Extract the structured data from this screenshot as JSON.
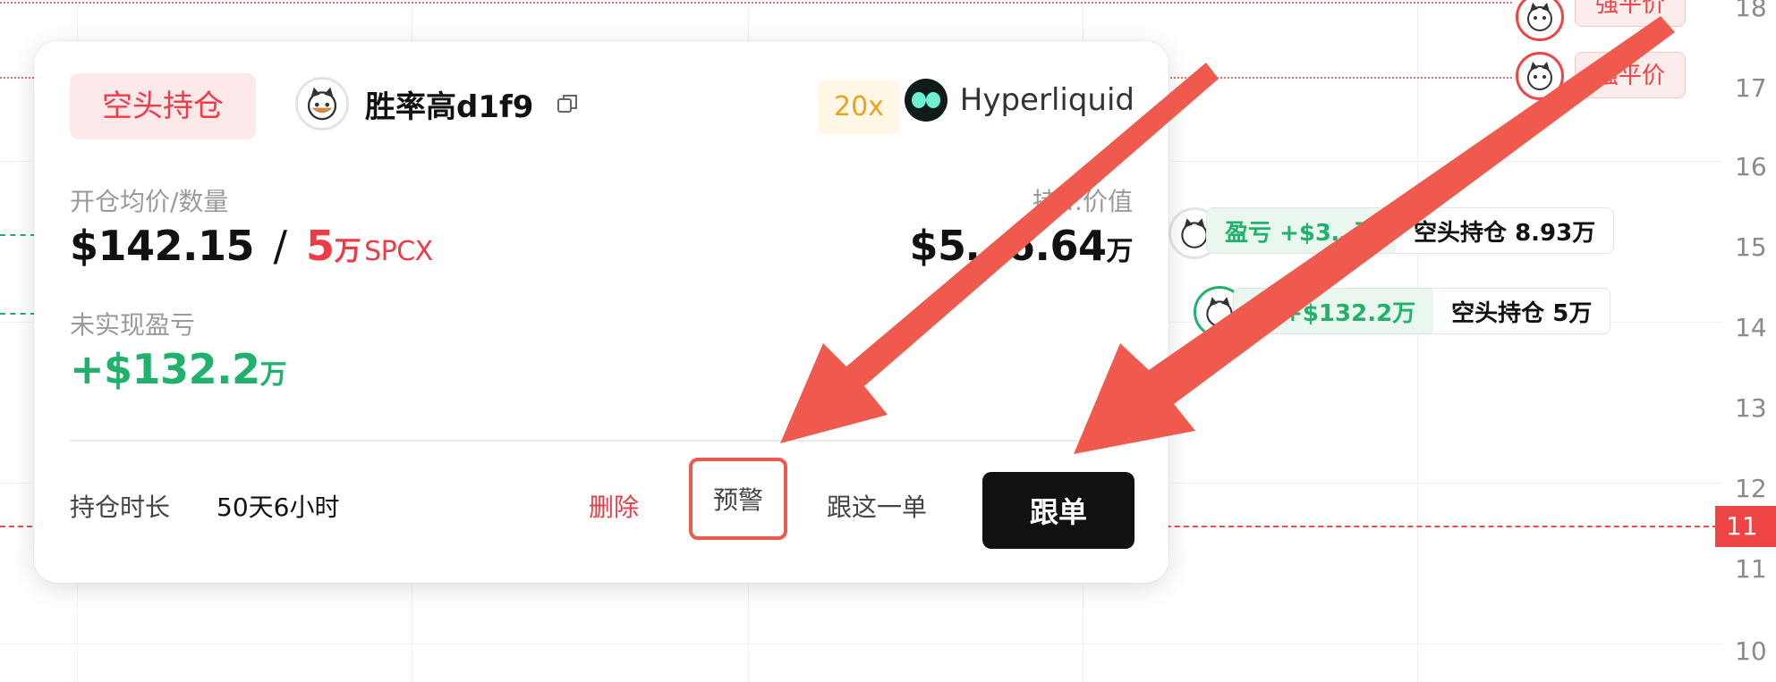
{
  "chart_bg": {
    "y_axis_labels": [
      "18",
      "17",
      "16",
      "15",
      "14",
      "13",
      "12",
      "11",
      "11",
      "10"
    ],
    "current_price_tag": "11",
    "liquidation_tags": [
      "强平价",
      "强平价"
    ],
    "position_chips": [
      {
        "pnl": "盈亏 +$3…万",
        "size": "空头持仓 8.93万"
      },
      {
        "pnl": "亏 +$132.2万",
        "size": "空头持仓 5万"
      }
    ]
  },
  "card": {
    "side_badge": "空头持仓",
    "trader_name": "胜率高d1f9",
    "leverage": "20x",
    "exchange": "Hyperliquid",
    "entry_label": "开仓均价/数量",
    "entry_price": "$142.15",
    "separator": "/",
    "qty": "5",
    "qty_unit": "万",
    "asset": "SPCX",
    "value_label_visible": "持…价值",
    "value_amount": "$5…6.64",
    "value_unit": "万",
    "pnl_label": "未实现盈亏",
    "pnl_amount": "+$132.2",
    "pnl_unit": "万",
    "hold_label": "持仓时长",
    "hold_value": "50天6小时",
    "delete_label": "删除",
    "alert_label": "预警",
    "copy_one_label": "跟这一单",
    "follow_label": "跟单"
  },
  "colors": {
    "short_red": "#ef3b46",
    "profit_green": "#20b26c",
    "annotation_arrow": "#f05a4e",
    "follow_button_bg": "#111111"
  }
}
